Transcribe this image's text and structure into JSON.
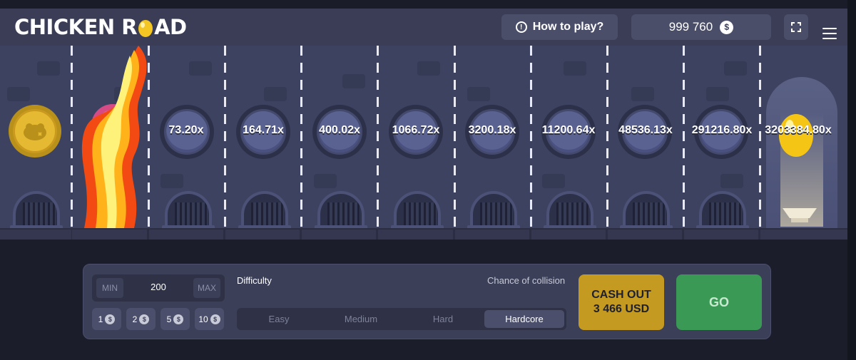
{
  "header": {
    "logo_prefix": "CHICKEN R",
    "logo_suffix": "AD",
    "how_to_play": "How to play?",
    "balance": "999 760",
    "currency_symbol": "$"
  },
  "board": {
    "multipliers": [
      "73.20x",
      "164.71x",
      "400.02x",
      "1066.72x",
      "3200.18x",
      "11200.64x",
      "48536.13x",
      "291216.80x",
      "3203384.80x"
    ]
  },
  "controls": {
    "bet_min": "MIN",
    "bet_value": "200",
    "bet_max": "MAX",
    "chips": [
      "1",
      "2",
      "5",
      "10"
    ],
    "chip_currency": "$",
    "difficulty_label": "Difficulty",
    "chance_label": "Chance of collision",
    "difficulties": [
      "Easy",
      "Medium",
      "Hard",
      "Hardcore"
    ],
    "selected_difficulty": "Hardcore",
    "cash_out_label": "CASH OUT",
    "cash_out_amount": "3 466 USD",
    "go_label": "GO"
  },
  "colors": {
    "header_bg": "#3a3d55",
    "cash_out": "#c49a21",
    "go": "#3a9954",
    "gold": "#e6b932"
  }
}
